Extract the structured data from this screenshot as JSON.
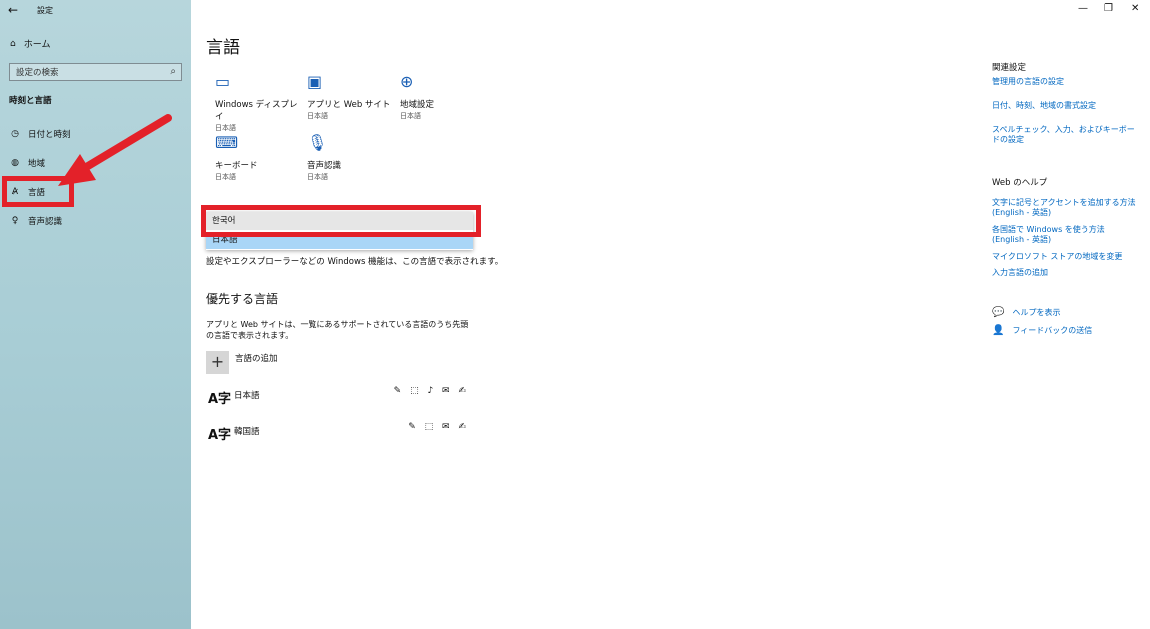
{
  "window": {
    "title": "設定",
    "back_glyph": "←",
    "minimize_glyph": "—",
    "maximize_glyph": "❐",
    "close_glyph": "✕"
  },
  "sidebar": {
    "home_label": "ホーム",
    "search_placeholder": "設定の検索",
    "section_title": "時刻と言語",
    "items": [
      {
        "label": "日付と時刻",
        "icon": "calendar-clock-icon"
      },
      {
        "label": "地域",
        "icon": "globe-icon"
      },
      {
        "label": "言語",
        "icon": "language-icon",
        "selected": true
      },
      {
        "label": "音声認識",
        "icon": "microphone-icon"
      }
    ]
  },
  "main": {
    "title": "言語",
    "tiles": [
      {
        "name": "Windows ディスプレイ",
        "sub": "日本語",
        "icon": "monitor-icon"
      },
      {
        "name": "アプリと Web サイト",
        "sub": "日本語",
        "icon": "app-window-icon"
      },
      {
        "name": "地域設定",
        "sub": "日本語",
        "icon": "globe-settings-icon"
      },
      {
        "name": "キーボード",
        "sub": "日本語",
        "icon": "keyboard-icon"
      },
      {
        "name": "音声認識",
        "sub": "日本語",
        "icon": "microphone-icon"
      }
    ],
    "display_dropdown": {
      "options": [
        "한국어",
        "日本語"
      ],
      "selected": "日本語",
      "hover": "한국어"
    },
    "display_note": "設定やエクスプローラーなどの Windows 機能は、この言語で表示されます。",
    "preferred_title": "優先する言語",
    "preferred_desc": "アプリと Web サイトは、一覧にあるサポートされている言語のうち先頭の言語で表示されます。",
    "add_language_label": "言語の追加",
    "languages": [
      {
        "name": "日本語",
        "feature_glyphs": "✎ ⬚ ♪ ✉ ✍"
      },
      {
        "name": "韓国語",
        "feature_glyphs": "✎ ⬚ ✉ ✍"
      }
    ]
  },
  "right": {
    "related_title": "関連設定",
    "related_links": [
      "管理用の言語の設定",
      "日付、時刻、地域の書式設定",
      "スペルチェック、入力、およびキーボードの設定"
    ],
    "help_title": "Web のヘルプ",
    "help_links": [
      "文字に記号とアクセントを追加する方法 (English - 英語)",
      "各国語で Windows を使う方法 (English - 英語)",
      "マイクロソフト ストアの地域を変更",
      "入力言語の追加"
    ],
    "get_help": "ヘルプを表示",
    "feedback": "フィードバックの送信"
  },
  "colors": {
    "sidebar_bg": "#a8cdd5",
    "accent_link": "#0067c0",
    "annotation_red": "#e32129",
    "dropdown_selected": "#a9d6f7"
  }
}
